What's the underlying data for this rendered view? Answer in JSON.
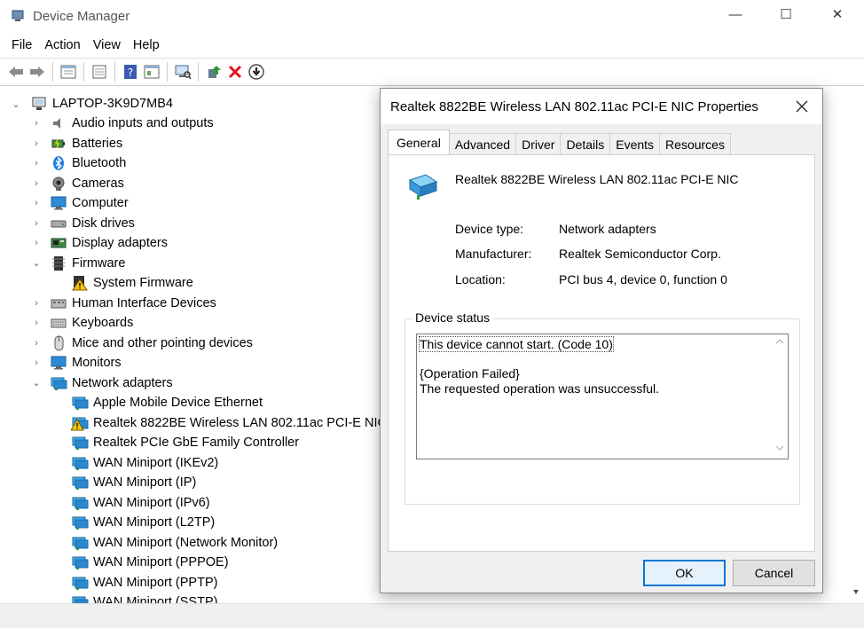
{
  "window": {
    "title": "Device Manager",
    "controls": {
      "minimize": "—",
      "maximize": "☐",
      "close": "✕"
    }
  },
  "menu": [
    "File",
    "Action",
    "View",
    "Help"
  ],
  "toolbar": {
    "icons": [
      "back-icon",
      "forward-icon",
      "properties-grid-icon",
      "details-icon",
      "help-icon",
      "details-pane-icon",
      "scan-hardware-icon",
      "update-driver-icon",
      "uninstall-icon",
      "disable-icon"
    ]
  },
  "tree": {
    "root": "LAPTOP-3K9D7MB4",
    "items": [
      {
        "label": "Audio inputs and outputs",
        "icon": "speaker-icon",
        "expanded": false
      },
      {
        "label": "Batteries",
        "icon": "battery-icon",
        "expanded": false
      },
      {
        "label": "Bluetooth",
        "icon": "bluetooth-icon",
        "expanded": false
      },
      {
        "label": "Cameras",
        "icon": "camera-icon",
        "expanded": false
      },
      {
        "label": "Computer",
        "icon": "monitor-icon",
        "expanded": false
      },
      {
        "label": "Disk drives",
        "icon": "disk-icon",
        "expanded": false
      },
      {
        "label": "Display adapters",
        "icon": "display-adapter-icon",
        "expanded": false
      },
      {
        "label": "Firmware",
        "icon": "firmware-icon",
        "expanded": true
      },
      {
        "label": "System Firmware",
        "icon": "warning-icon",
        "child": true
      },
      {
        "label": "Human Interface Devices",
        "icon": "hid-icon",
        "expanded": false
      },
      {
        "label": "Keyboards",
        "icon": "keyboard-icon",
        "expanded": false
      },
      {
        "label": "Mice and other pointing devices",
        "icon": "mouse-icon",
        "expanded": false
      },
      {
        "label": "Monitors",
        "icon": "monitor-icon",
        "expanded": false
      },
      {
        "label": "Network adapters",
        "icon": "network-icon",
        "expanded": true
      },
      {
        "label": "Apple Mobile Device Ethernet",
        "icon": "network-icon",
        "child": true
      },
      {
        "label": "Realtek 8822BE Wireless LAN 802.11ac PCI-E NIC",
        "icon": "network-warning-icon",
        "child": true
      },
      {
        "label": "Realtek PCIe GbE Family Controller",
        "icon": "network-icon",
        "child": true
      },
      {
        "label": "WAN Miniport (IKEv2)",
        "icon": "network-icon",
        "child": true
      },
      {
        "label": "WAN Miniport (IP)",
        "icon": "network-icon",
        "child": true
      },
      {
        "label": "WAN Miniport (IPv6)",
        "icon": "network-icon",
        "child": true
      },
      {
        "label": "WAN Miniport (L2TP)",
        "icon": "network-icon",
        "child": true
      },
      {
        "label": "WAN Miniport (Network Monitor)",
        "icon": "network-icon",
        "child": true
      },
      {
        "label": "WAN Miniport (PPPOE)",
        "icon": "network-icon",
        "child": true
      },
      {
        "label": "WAN Miniport (PPTP)",
        "icon": "network-icon",
        "child": true
      },
      {
        "label": "WAN Miniport (SSTP)",
        "icon": "network-icon",
        "child": true
      }
    ]
  },
  "dialog": {
    "title": "Realtek 8822BE Wireless LAN 802.11ac PCI-E NIC Properties",
    "close": "✕",
    "tabs": [
      "General",
      "Advanced",
      "Driver",
      "Details",
      "Events",
      "Resources"
    ],
    "active_tab": "General",
    "device_name": "Realtek 8822BE Wireless LAN 802.11ac PCI-E NIC",
    "fields": [
      {
        "label": "Device type:",
        "value": "Network adapters"
      },
      {
        "label": "Manufacturer:",
        "value": "Realtek Semiconductor Corp."
      },
      {
        "label": "Location:",
        "value": "PCI bus 4, device 0, function 0"
      }
    ],
    "status_group_label": "Device status",
    "status_lines": [
      "This device cannot start. (Code 10)",
      "",
      "{Operation Failed}",
      "The requested operation was unsuccessful."
    ],
    "ok": "OK",
    "cancel": "Cancel"
  },
  "colors": {
    "accent": "#0078d7",
    "error_red": "#e81123",
    "warning_yellow": "#f6c700",
    "network_blue": "#3a9bd9"
  }
}
